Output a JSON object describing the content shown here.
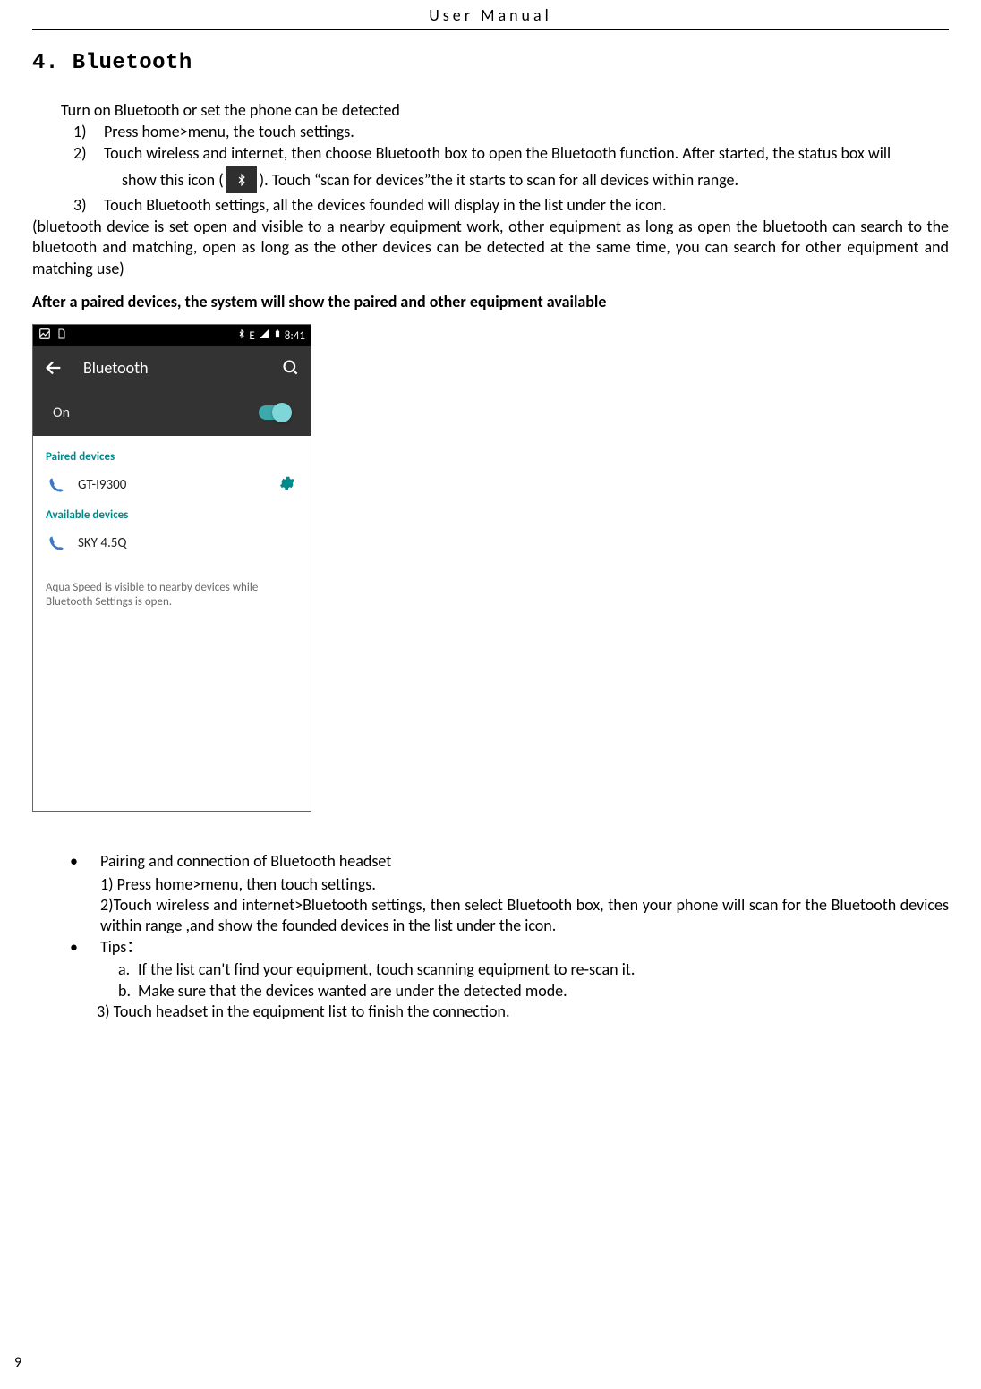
{
  "header": {
    "title": "User    Manual",
    "page_number": "9"
  },
  "section": {
    "heading": "4. Bluetooth"
  },
  "intro": "Turn on Bluetooth or set the phone can be detected",
  "steps": {
    "1": {
      "num": "1)",
      "text": "Press home>menu, the touch settings."
    },
    "2": {
      "num": "2)",
      "line1": "Touch wireless and internet, then choose Bluetooth box to open the Bluetooth function. After started, the status box will",
      "line2a": "show this icon (",
      "line2b": "). Touch  “scan for devices”the it starts to scan for all devices within range."
    },
    "3": {
      "num": "3)",
      "text": "Touch Bluetooth settings, all the devices founded will display in the list under the icon."
    }
  },
  "note": "(bluetooth device is set open and visible to a nearby equipment work, other equipment as long as open the bluetooth can search to the bluetooth and matching, open as long as the other devices can be detected at the same time, you can search for other equipment and matching use)",
  "after_paired": "After a paired devices, the system will show the paired and other equipment available",
  "phone": {
    "status": {
      "time": "8:41"
    },
    "appbar": {
      "title": "Bluetooth",
      "state": "On"
    },
    "sections": {
      "paired_label": "Paired devices",
      "paired_device": "GT-I9300",
      "available_label": "Available devices",
      "available_device": "SKY 4.5Q",
      "visibility": "Aqua Speed is visible to nearby devices while Bluetooth Settings is open."
    }
  },
  "bullets": {
    "pairing": {
      "title": "Pairing and connection of Bluetooth headset",
      "s1": "1) Press home>menu, then touch settings.",
      "s2": "2)Touch wireless and internet>Bluetooth settings, then select Bluetooth box, then your phone will scan for the Bluetooth devices within range ,and show the founded devices in the list under the icon."
    },
    "tips": {
      "title": "Tips：",
      "a_lab": "a.",
      "a": "If the list can't find your equipment, touch scanning equipment to re-scan it.",
      "b_lab": "b.",
      "b": "Make sure that the devices wanted are under the detected mode.",
      "s3": "3) Touch headset in the equipment list to finish the connection."
    }
  }
}
